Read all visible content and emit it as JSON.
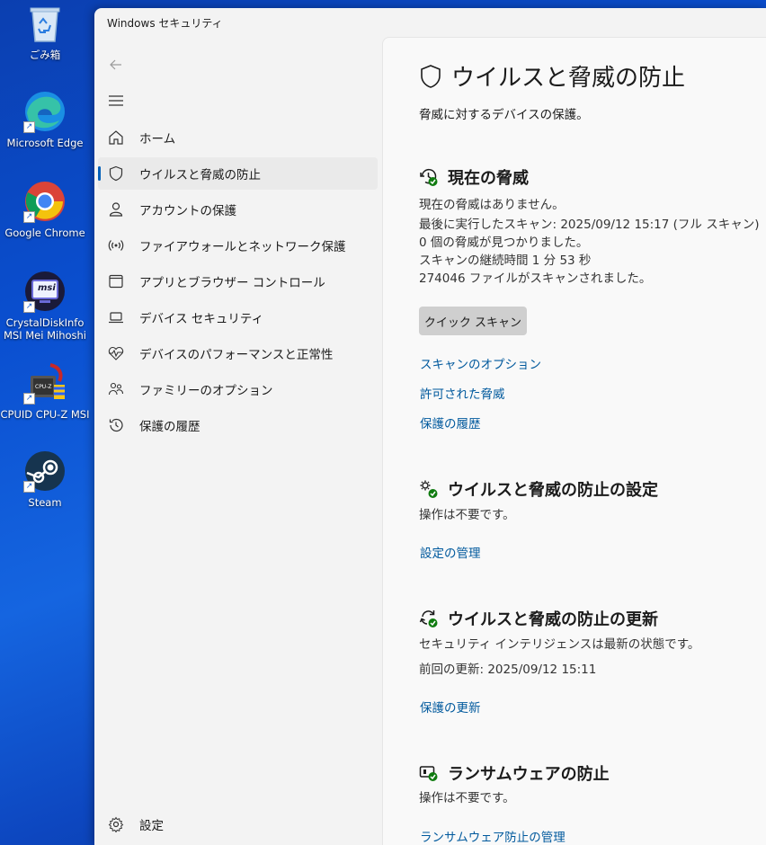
{
  "desktop": {
    "icons": [
      {
        "label": "ごみ箱",
        "icon": "recycle-bin-icon"
      },
      {
        "label": "Microsoft Edge",
        "icon": "edge-icon"
      },
      {
        "label": "Google Chrome",
        "icon": "chrome-icon"
      },
      {
        "label": "CrystalDiskInfo\nMSI Mei Mihoshi",
        "icon": "crystaldiskinfo-icon"
      },
      {
        "label": "CPUID CPU-Z MSI",
        "icon": "cpuz-icon"
      },
      {
        "label": "Steam",
        "icon": "steam-icon"
      }
    ],
    "cpuz_badge": "CPU-Z",
    "msi_badge": "msi"
  },
  "window": {
    "title": "Windows セキュリティ"
  },
  "nav": {
    "items": [
      {
        "label": "ホーム",
        "icon": "home-icon"
      },
      {
        "label": "ウイルスと脅威の防止",
        "icon": "shield-icon"
      },
      {
        "label": "アカウントの保護",
        "icon": "person-icon"
      },
      {
        "label": "ファイアウォールとネットワーク保護",
        "icon": "wireless-icon"
      },
      {
        "label": "アプリとブラウザー コントロール",
        "icon": "app-window-icon"
      },
      {
        "label": "デバイス セキュリティ",
        "icon": "laptop-icon"
      },
      {
        "label": "デバイスのパフォーマンスと正常性",
        "icon": "heartbeat-icon"
      },
      {
        "label": "ファミリーのオプション",
        "icon": "family-icon"
      },
      {
        "label": "保護の履歴",
        "icon": "history-icon"
      }
    ],
    "settings_label": "設定"
  },
  "main": {
    "title": "ウイルスと脅威の防止",
    "subtitle": "脅威に対するデバイスの保護。",
    "current_threats": {
      "heading": "現在の脅威",
      "status": "現在の脅威はありません。",
      "last_scan": "最後に実行したスキャン: 2025/09/12 15:17 (フル スキャン)",
      "threats_found": "0 個の脅威が見つかりました。",
      "duration": "スキャンの継続時間 1 分 53 秒",
      "files_scanned": "274046 ファイルがスキャンされました。",
      "quick_scan_button": "クイック スキャン",
      "links": [
        "スキャンのオプション",
        "許可された脅威",
        "保護の履歴"
      ]
    },
    "settings": {
      "heading": "ウイルスと脅威の防止の設定",
      "status": "操作は不要です。",
      "link": "設定の管理"
    },
    "updates": {
      "heading": "ウイルスと脅威の防止の更新",
      "status": "セキュリティ インテリジェンスは最新の状態です。",
      "last_update": "前回の更新: 2025/09/12 15:11",
      "link": "保護の更新"
    },
    "ransomware": {
      "heading": "ランサムウェアの防止",
      "status": "操作は不要です。",
      "link": "ランサムウェア防止の管理"
    }
  },
  "colors": {
    "accent": "#005fb8",
    "link": "#00599d",
    "ok_badge": "#0f7b0f"
  }
}
